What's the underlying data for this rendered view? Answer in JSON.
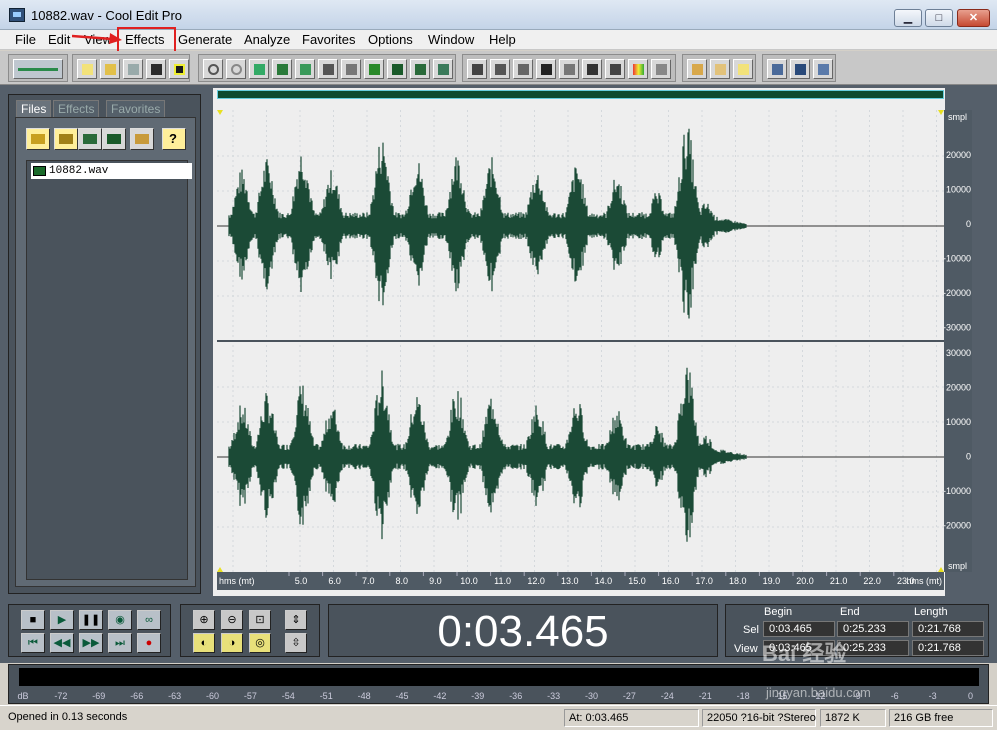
{
  "window": {
    "title": "10882.wav - Cool Edit Pro",
    "min": "▁",
    "max": "□",
    "close": "✕"
  },
  "menu": [
    "File",
    "Edit",
    "View",
    "Effects",
    "Generate",
    "Analyze",
    "Favorites",
    "Options",
    "Window",
    "Help"
  ],
  "organizer": {
    "tabs": [
      "Files",
      "Effects",
      "Favorites"
    ],
    "files": [
      "10882.wav"
    ]
  },
  "ruler": {
    "unit": "hms (mt)",
    "ticks": [
      "5.0",
      "6.0",
      "7.0",
      "8.0",
      "9.0",
      "10.0",
      "11.0",
      "12.0",
      "13.0",
      "14.0",
      "15.0",
      "16.0",
      "17.0",
      "18.0",
      "19.0",
      "20.0",
      "21.0",
      "22.0",
      "23.0"
    ]
  },
  "yscale": {
    "unit": "smpl",
    "top_channel": [
      "20000",
      "10000",
      "0",
      "-10000",
      "-20000",
      "-30000"
    ],
    "bottom_channel": [
      "30000",
      "20000",
      "10000",
      "0",
      "-10000",
      "-20000"
    ]
  },
  "time_display": "0:03.465",
  "selection": {
    "headers": {
      "begin": "Begin",
      "end": "End",
      "length": "Length"
    },
    "sel": {
      "label": "Sel",
      "begin": "0:03.465",
      "end": "0:25.233",
      "length": "0:21.768"
    },
    "view": {
      "label": "View",
      "begin": "0:03.465",
      "end": "0:25.233",
      "length": "0:21.768"
    }
  },
  "level_meter": {
    "scale": [
      "dB",
      "-72",
      "-69",
      "-66",
      "-63",
      "-60",
      "-57",
      "-54",
      "-51",
      "-48",
      "-45",
      "-42",
      "-39",
      "-36",
      "-33",
      "-30",
      "-27",
      "-24",
      "-21",
      "-18",
      "-15",
      "-12",
      "-9",
      "-6",
      "-3",
      "0"
    ]
  },
  "status": {
    "message": "Opened in 0.13 seconds",
    "at": "At:  0:03.465",
    "format": "22050 ?16-bit ?Stereo",
    "size": "1872 K",
    "free": "216 GB free"
  },
  "watermark": {
    "brand": "Bai 经验",
    "url": "jingyan.baidu.com"
  },
  "colors": {
    "wave": "#1b4a36",
    "highlight": "#e02020"
  }
}
